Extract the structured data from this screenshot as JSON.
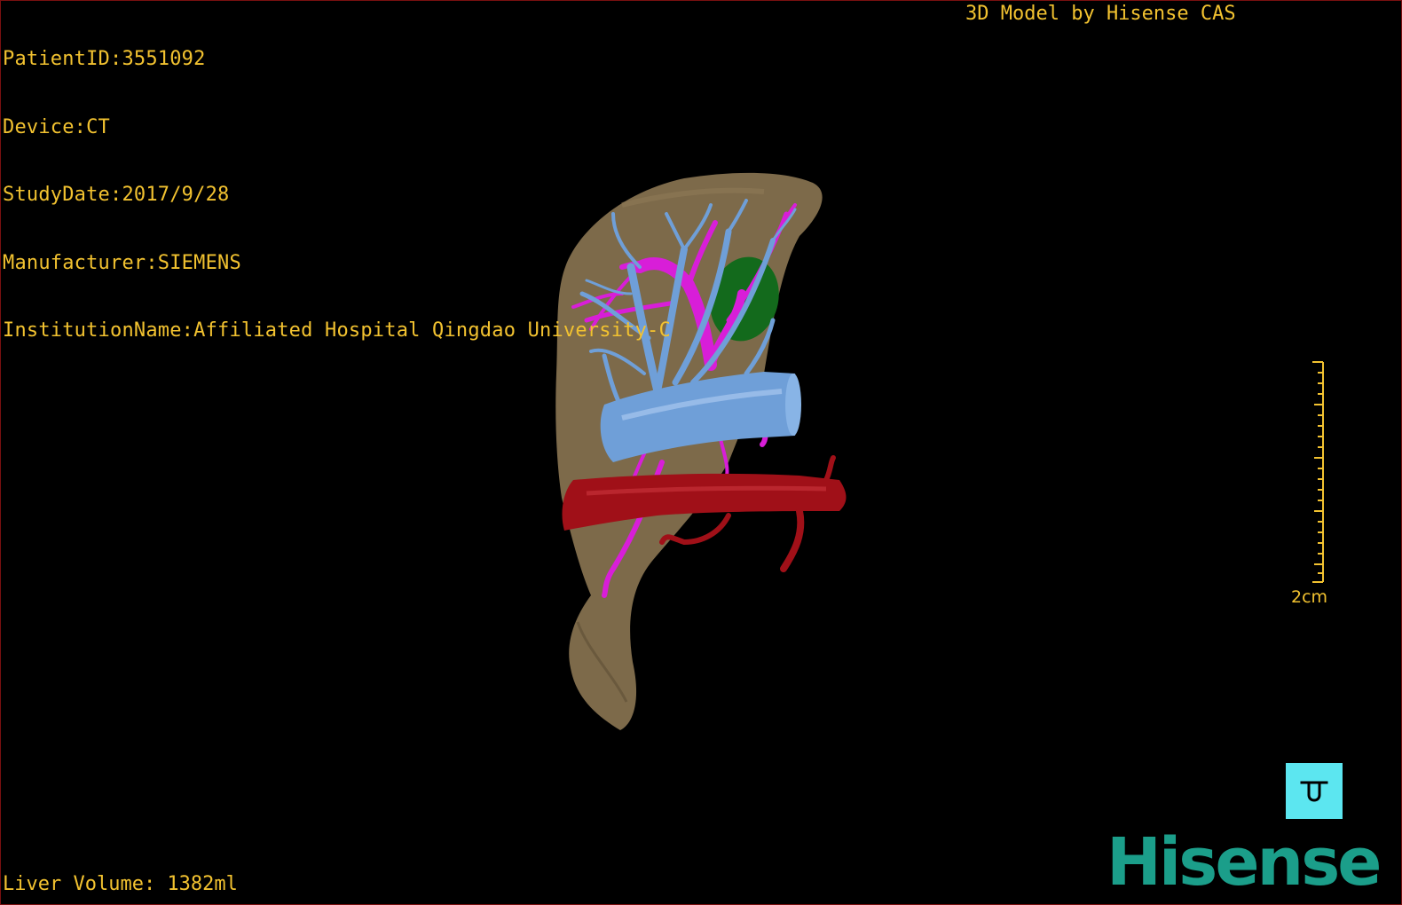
{
  "overlay": {
    "patient_id": "PatientID:3551092",
    "device": "Device:CT",
    "study_date": "StudyDate:2017/9/28",
    "manufacturer": "Manufacturer:SIEMENS",
    "institution": "InstitutionName:Affiliated Hospital Qingdao University-C",
    "credit": "3D Model by Hisense CAS",
    "liver_volume": "Liver Volume: 1382ml"
  },
  "scale": {
    "label": "2cm"
  },
  "brand": {
    "logo_text": "Hisense"
  },
  "colors": {
    "overlay_text": "#f2c230",
    "liver": "#7d6a4a",
    "portal_vein": "#6f9fd8",
    "hepatic_vessels": "#d81ed8",
    "artery": "#a01018",
    "gallbladder": "#136a1c",
    "orientation_button": "#5ce6f0",
    "brand": "#1b9e8a"
  },
  "icons": {
    "orientation": "orientation-cube-icon"
  }
}
